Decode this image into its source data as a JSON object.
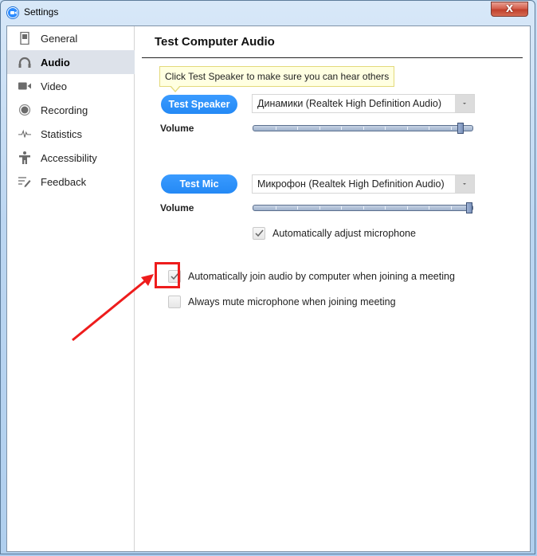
{
  "window": {
    "title": "Settings",
    "close_label": "X"
  },
  "sidebar": {
    "items": [
      {
        "label": "General",
        "icon": "general-icon",
        "active": false
      },
      {
        "label": "Audio",
        "icon": "headphones-icon",
        "active": true
      },
      {
        "label": "Video",
        "icon": "video-camera-icon",
        "active": false
      },
      {
        "label": "Recording",
        "icon": "record-icon",
        "active": false
      },
      {
        "label": "Statistics",
        "icon": "pulse-icon",
        "active": false
      },
      {
        "label": "Accessibility",
        "icon": "accessibility-icon",
        "active": false
      },
      {
        "label": "Feedback",
        "icon": "feedback-icon",
        "active": false
      }
    ]
  },
  "main": {
    "section_title": "Test Computer Audio",
    "tooltip": "Click Test Speaker to make sure you can hear others",
    "speaker": {
      "button_label": "Test Speaker",
      "device": "Динамики (Realtek High Definition Audio)",
      "volume_label": "Volume",
      "volume_percent": 96
    },
    "mic": {
      "button_label": "Test Mic",
      "device": "Микрофон (Realtek High Definition Audio)",
      "volume_label": "Volume",
      "volume_percent": 100,
      "auto_adjust": {
        "label": "Automatically adjust microphone",
        "checked": true
      }
    },
    "options": [
      {
        "label": "Automatically join audio by computer when joining a meeting",
        "checked": true,
        "highlighted": true
      },
      {
        "label": "Always mute microphone when joining meeting",
        "checked": false,
        "highlighted": false
      }
    ]
  },
  "annotation": {
    "color": "#ee1c1c"
  }
}
